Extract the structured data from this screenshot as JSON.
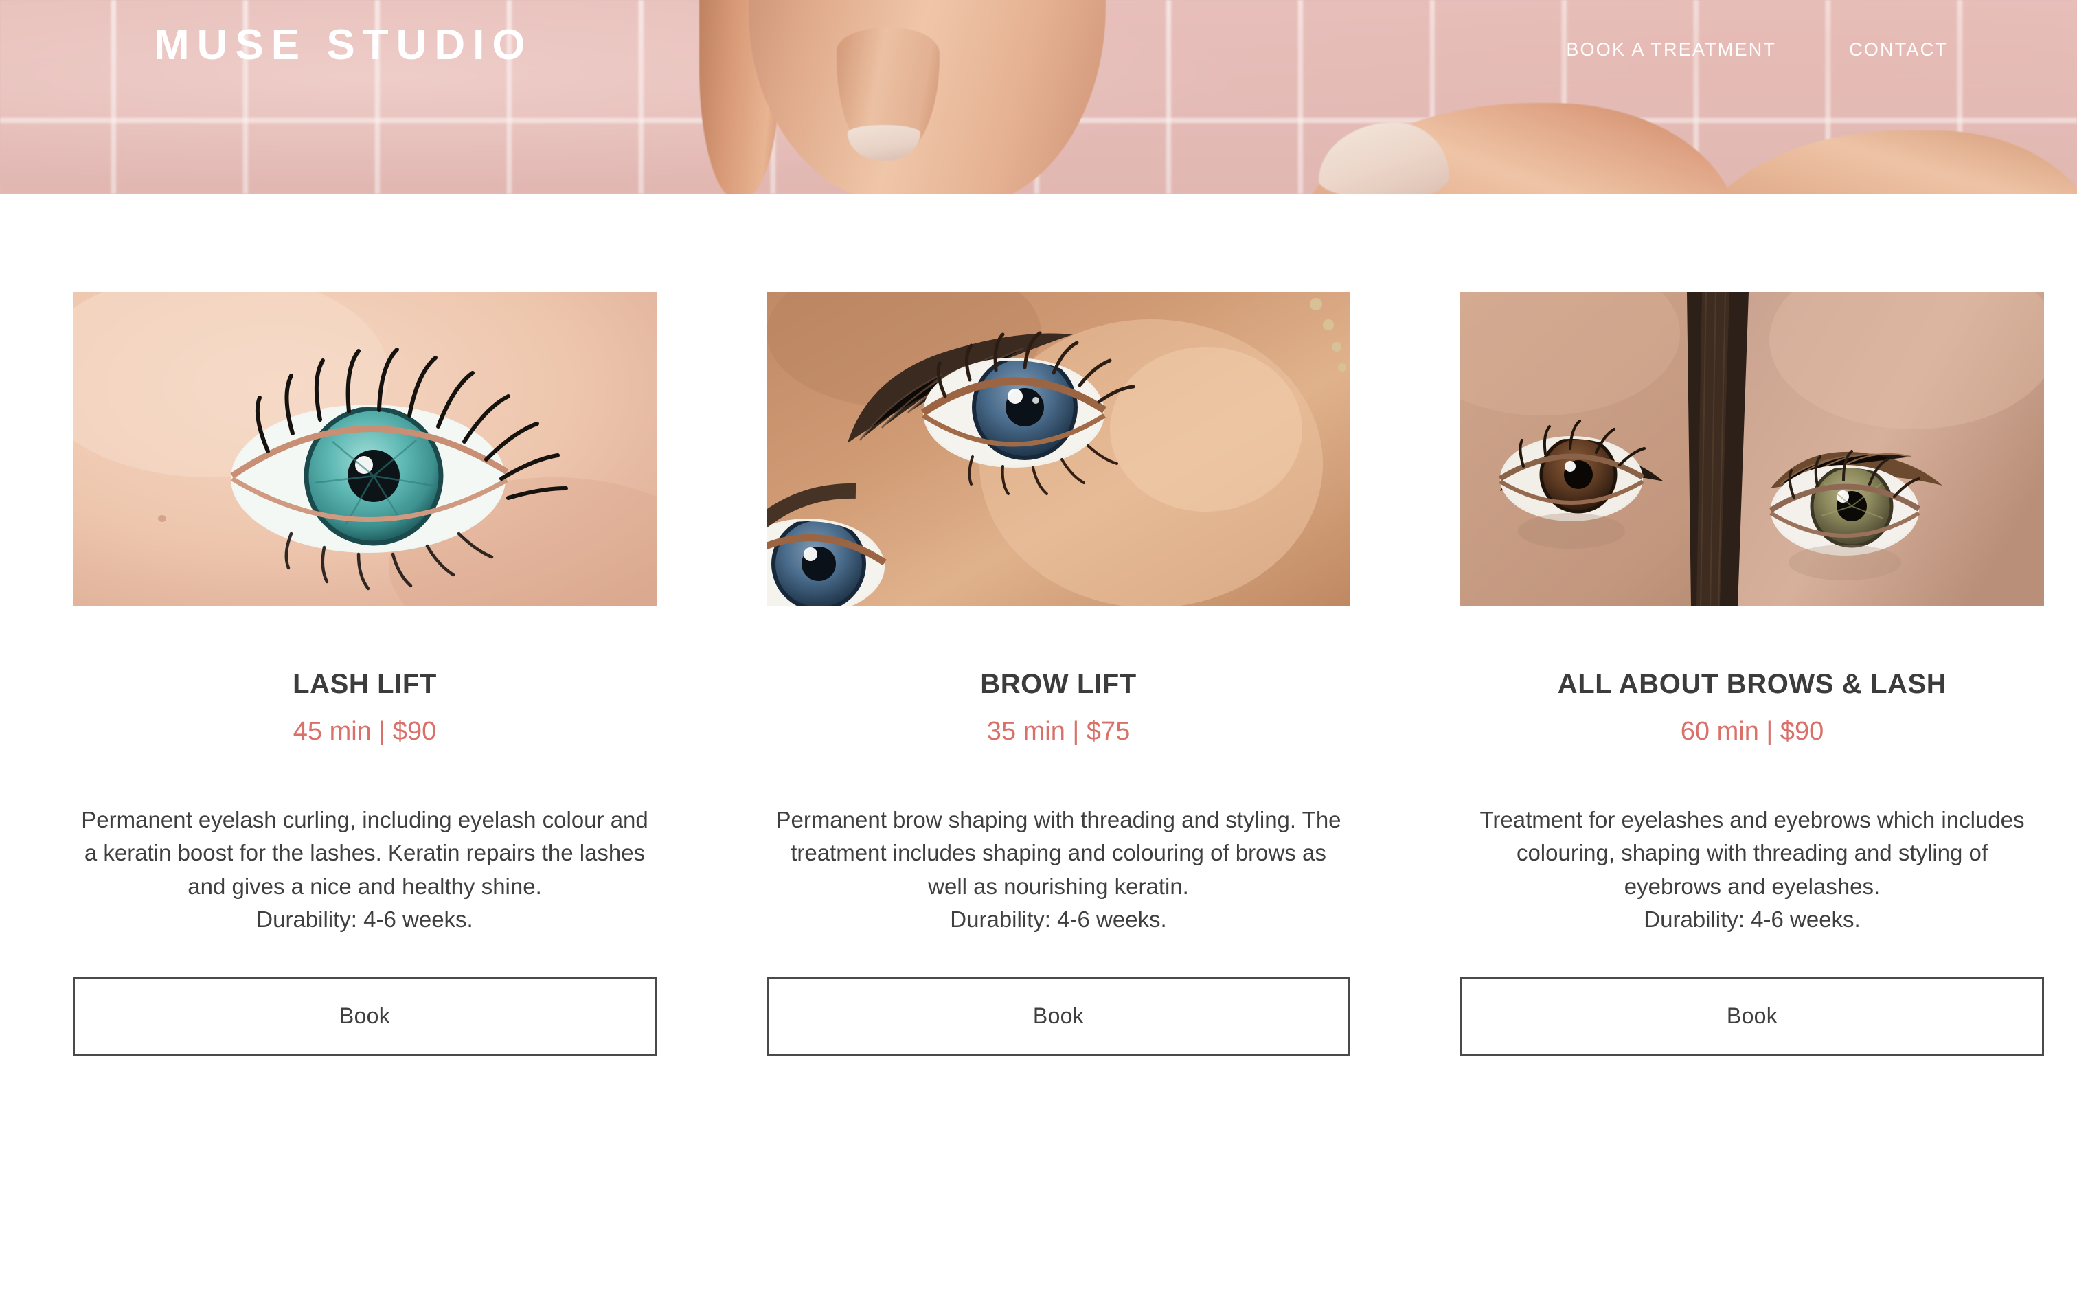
{
  "header": {
    "brand": "MUSE STUDIO",
    "nav": [
      {
        "label": "BOOK A TREATMENT",
        "name": "nav-book-a-treatment"
      },
      {
        "label": "CONTACT",
        "name": "nav-contact"
      }
    ],
    "colors": {
      "tile_pink": "#e6bcb7",
      "grout_white": "#ffffff",
      "logo_text": "#ffffff"
    }
  },
  "colors": {
    "price_accent": "#d9706a",
    "heading_text": "#3c3c3c",
    "body_text": "#3f3f3f",
    "button_border": "#4a4a4a",
    "page_background": "#ffffff"
  },
  "services": [
    {
      "title": "LASH LIFT",
      "price": "45 min | $90",
      "duration": "45 min",
      "cost": "$90",
      "description": "Permanent eyelash curling, including eyelash colour and a keratin boost for the lashes. Keratin repairs the lashes and gives a nice and healthy shine.",
      "durability": "Durability: 4-6 weeks.",
      "button_label": "Book",
      "image_alt": "close-up-of-teal-blue-eye-with-long-curled-lashes"
    },
    {
      "title": "BROW LIFT",
      "price": "35 min | $75",
      "duration": "35 min",
      "cost": "$75",
      "description": "Permanent brow shaping with threading and styling. The treatment includes shaping and colouring of brows as well as nourishing keratin.",
      "durability": "Durability: 4-6 weeks.",
      "button_label": "Book",
      "image_alt": "close-up-of-bronzed-face-with-blue-eyes-and-shaped-brows"
    },
    {
      "title": "ALL ABOUT BROWS & LASH",
      "price": "60 min | $90",
      "duration": "60 min",
      "cost": "$90",
      "description": "Treatment for eyelashes and eyebrows which includes colouring, shaping with threading and styling of eyebrows and eyelashes.",
      "durability": "Durability: 4-6 weeks.",
      "button_label": "Book",
      "image_alt": "two-faces-side-by-side-showing-brown-and-hazel-eyes-with-brows"
    }
  ]
}
